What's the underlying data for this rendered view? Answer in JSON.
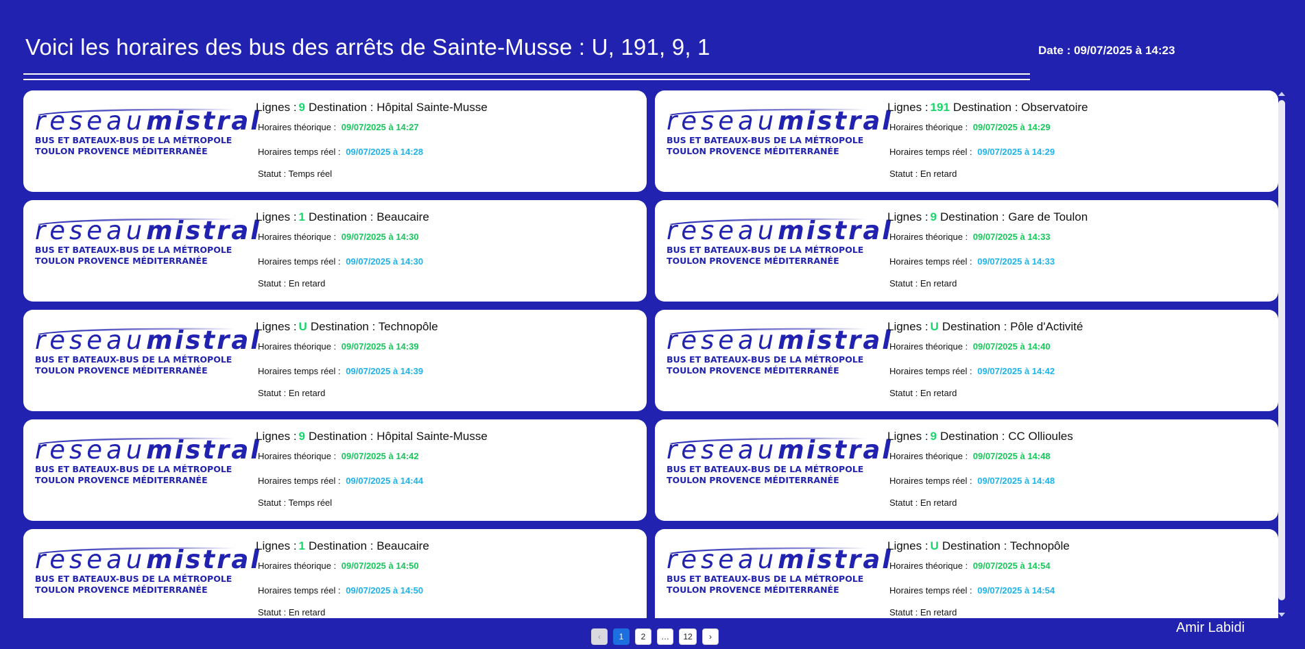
{
  "header": {
    "title": "Voici les horaires des bus des arrêts de Sainte-Musse : U, 191, 9, 1",
    "date": "Date : 09/07/2025 à 14:23"
  },
  "logo": {
    "word_thin": "reseau",
    "word_bold": "mistral",
    "sub1": "BUS ET BATEAUX-BUS DE LA MÉTROPOLE",
    "sub2": "TOULON PROVENCE MÉDITERRANÉE"
  },
  "labels": {
    "lignes": "Lignes :",
    "destination": "Destination :",
    "theorique": "Horaires théorique :",
    "temps_reel": "Horaires temps réel :",
    "statut": "Statut :"
  },
  "cards": [
    {
      "line": "9",
      "destination": "Hôpital Sainte-Musse",
      "theorique": "09/07/2025 à 14:27",
      "reel": "09/07/2025 à 14:28",
      "statut": "Temps réel"
    },
    {
      "line": "191",
      "destination": "Observatoire",
      "theorique": "09/07/2025 à 14:29",
      "reel": "09/07/2025 à 14:29",
      "statut": "En retard"
    },
    {
      "line": "1",
      "destination": "Beaucaire",
      "theorique": "09/07/2025 à 14:30",
      "reel": "09/07/2025 à 14:30",
      "statut": "En retard"
    },
    {
      "line": "9",
      "destination": "Gare de Toulon",
      "theorique": "09/07/2025 à 14:33",
      "reel": "09/07/2025 à 14:33",
      "statut": "En retard"
    },
    {
      "line": "U",
      "destination": "Technopôle",
      "theorique": "09/07/2025 à 14:39",
      "reel": "09/07/2025 à 14:39",
      "statut": "En retard"
    },
    {
      "line": "U",
      "destination": "Pôle d'Activité",
      "theorique": "09/07/2025 à 14:40",
      "reel": "09/07/2025 à 14:42",
      "statut": "En retard"
    },
    {
      "line": "9",
      "destination": "Hôpital Sainte-Musse",
      "theorique": "09/07/2025 à 14:42",
      "reel": "09/07/2025 à 14:44",
      "statut": "Temps réel"
    },
    {
      "line": "9",
      "destination": "CC Ollioules",
      "theorique": "09/07/2025 à 14:48",
      "reel": "09/07/2025 à 14:48",
      "statut": "En retard"
    },
    {
      "line": "1",
      "destination": "Beaucaire",
      "theorique": "09/07/2025 à 14:50",
      "reel": "09/07/2025 à 14:50",
      "statut": "En retard"
    },
    {
      "line": "U",
      "destination": "Technopôle",
      "theorique": "09/07/2025 à 14:54",
      "reel": "09/07/2025 à 14:54",
      "statut": "En retard"
    }
  ],
  "pagination": {
    "prev": "‹",
    "pages": [
      "1",
      "2",
      "…",
      "12"
    ],
    "current": "1",
    "next": "›"
  },
  "author": "Amir Labidi"
}
